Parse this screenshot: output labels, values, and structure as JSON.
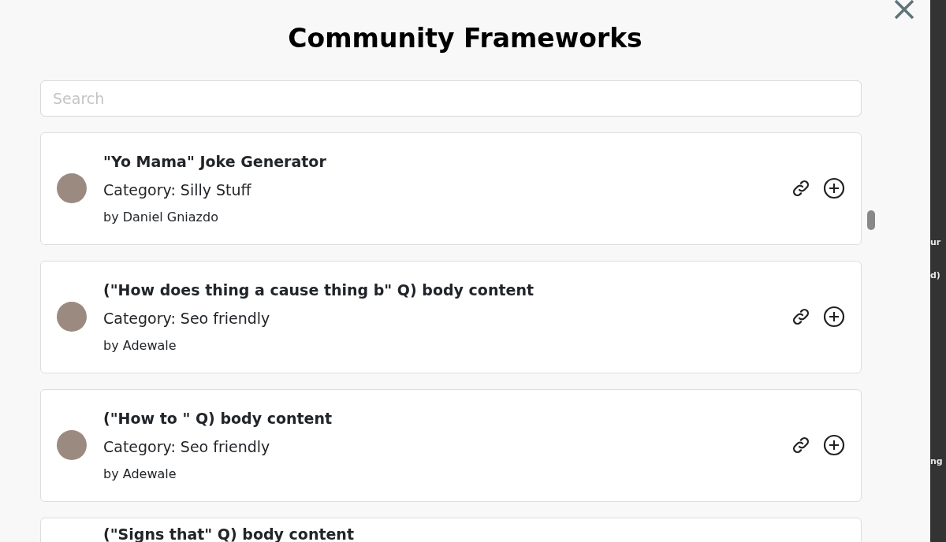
{
  "modal": {
    "title": "Community Frameworks",
    "search": {
      "placeholder": "Search"
    },
    "frameworks": [
      {
        "title": "\"Yo Mama\" Joke Generator",
        "category": "Category: Silly Stuff",
        "author": "by Daniel Gniazdo"
      },
      {
        "title": "(\"How does thing a cause thing b\" Q) body content",
        "category": "Category: Seo friendly",
        "author": "by Adewale"
      },
      {
        "title": "(\"How to \" Q) body content",
        "category": "Category: Seo friendly",
        "author": "by Adewale"
      },
      {
        "title": "(\"Signs that\" Q) body content"
      }
    ]
  },
  "background_fragments": [
    "ur",
    "d)",
    "ng"
  ]
}
